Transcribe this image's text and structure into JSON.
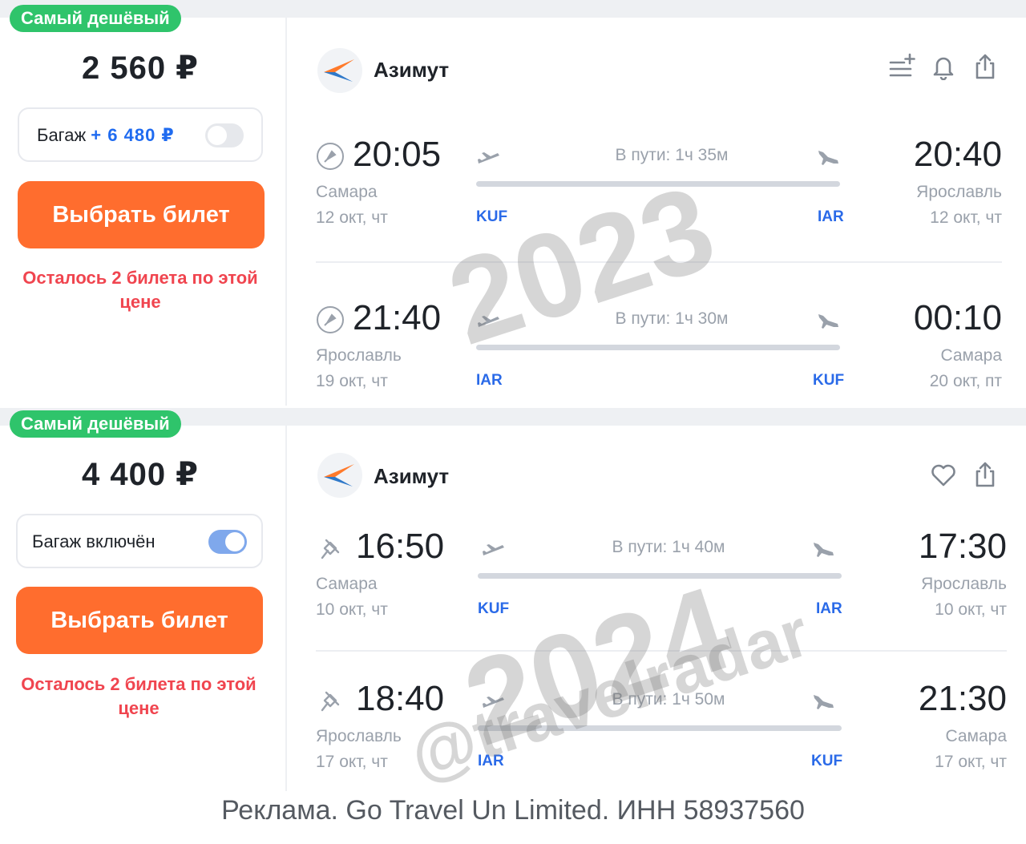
{
  "offers": [
    {
      "badge": "Самый дешёвый",
      "price": "2 560 ₽",
      "baggage": {
        "label": "Багаж",
        "extra": "+ 6 480 ₽",
        "toggle_on": false
      },
      "buy_label": "Выбрать билет",
      "warning": "Осталось 2 билета по этой цене",
      "airline": "Азимут",
      "actions": [
        "filter-add-icon",
        "bell-icon",
        "share-icon"
      ],
      "segments": [
        {
          "dep_time": "20:05",
          "arr_time": "20:40",
          "duration": "В пути: 1ч 35м",
          "dep_city": "Самара",
          "dep_date": "12 окт, чт",
          "dep_code": "KUF",
          "arr_city": "Ярославль",
          "arr_date": "12 окт, чт",
          "arr_code": "IAR"
        },
        {
          "dep_time": "21:40",
          "arr_time": "00:10",
          "duration": "В пути: 1ч 30м",
          "dep_city": "Ярославль",
          "dep_date": "19 окт, чт",
          "dep_code": "IAR",
          "arr_city": "Самара",
          "arr_date": "20 окт, пт",
          "arr_code": "KUF"
        }
      ]
    },
    {
      "badge": "Самый дешёвый",
      "price": "4 400 ₽",
      "baggage": {
        "label": "Багаж включён",
        "extra": "",
        "toggle_on": true
      },
      "buy_label": "Выбрать билет",
      "warning": "Осталось 2 билета по этой цене",
      "airline": "Азимут",
      "actions": [
        "heart-icon",
        "share-icon"
      ],
      "segments": [
        {
          "dep_time": "16:50",
          "arr_time": "17:30",
          "duration": "В пути: 1ч 40м",
          "dep_city": "Самара",
          "dep_date": "10 окт, чт",
          "dep_code": "KUF",
          "arr_city": "Ярославль",
          "arr_date": "10 окт, чт",
          "arr_code": "IAR"
        },
        {
          "dep_time": "18:40",
          "arr_time": "21:30",
          "duration": "В пути: 1ч 50м",
          "dep_city": "Ярославль",
          "dep_date": "17 окт, чт",
          "dep_code": "IAR",
          "arr_city": "Самара",
          "arr_date": "17 окт, чт",
          "arr_code": "KUF"
        }
      ]
    }
  ],
  "watermarks": [
    "2023",
    "2024",
    "@travelradar"
  ],
  "footer": "Реклама. Go Travel Un Limited. ИНН 58937560",
  "colors": {
    "accent": "#ff6d2e",
    "badge": "#2fc46b",
    "code": "#2a6ae8",
    "warning": "#f0454f"
  }
}
